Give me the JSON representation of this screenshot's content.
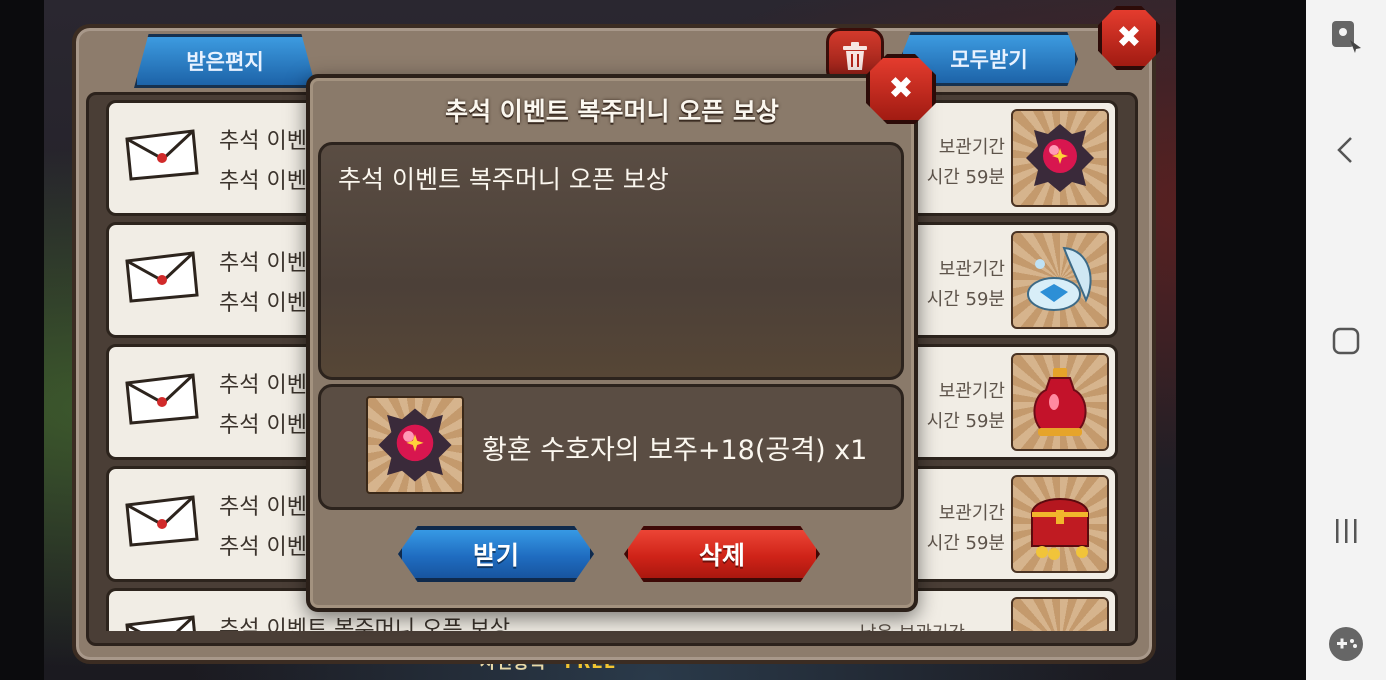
{
  "panel": {
    "tab_received": "받은편지",
    "receive_all_button": "모두받기"
  },
  "mails": [
    {
      "title": "추석 이벤",
      "subtitle": "추석 이벤",
      "keep_label": "보관기간",
      "time_left": "시간 59분",
      "item_icon": "crimson-orb-icon"
    },
    {
      "title": "추석 이벤",
      "subtitle": "추석 이벤",
      "keep_label": "보관기간",
      "time_left": "시간 59분",
      "item_icon": "pearl-shell-icon"
    },
    {
      "title": "추석 이벤",
      "subtitle": "추석 이벤",
      "keep_label": "보관기간",
      "time_left": "시간 59분",
      "item_icon": "red-potion-icon"
    },
    {
      "title": "추석 이벤",
      "subtitle": "추석 이벤",
      "keep_label": "보관기간",
      "time_left": "시간 59분",
      "item_icon": "treasure-chest-icon"
    },
    {
      "title": "추석 이벤트 복주머니 오픈 보상",
      "keep_label": "남은 보관기간",
      "item_icon": "syringe-icon"
    }
  ],
  "dialog": {
    "title": "추석 이벤트 복주머니 오픈 보상",
    "message": "추석 이벤트 복주머니 오픈 보상",
    "reward_text": "황혼 수호자의 보주+18(공격) x1",
    "reward_icon": "crimson-orb-icon",
    "accept_button": "받기",
    "delete_button": "삭제"
  },
  "background": {
    "bottom_text": "사전등록",
    "free_text": "FREE"
  },
  "colors": {
    "accept": "#1f6cc0",
    "delete": "#cf2318",
    "panel": "#8a7a6a"
  }
}
